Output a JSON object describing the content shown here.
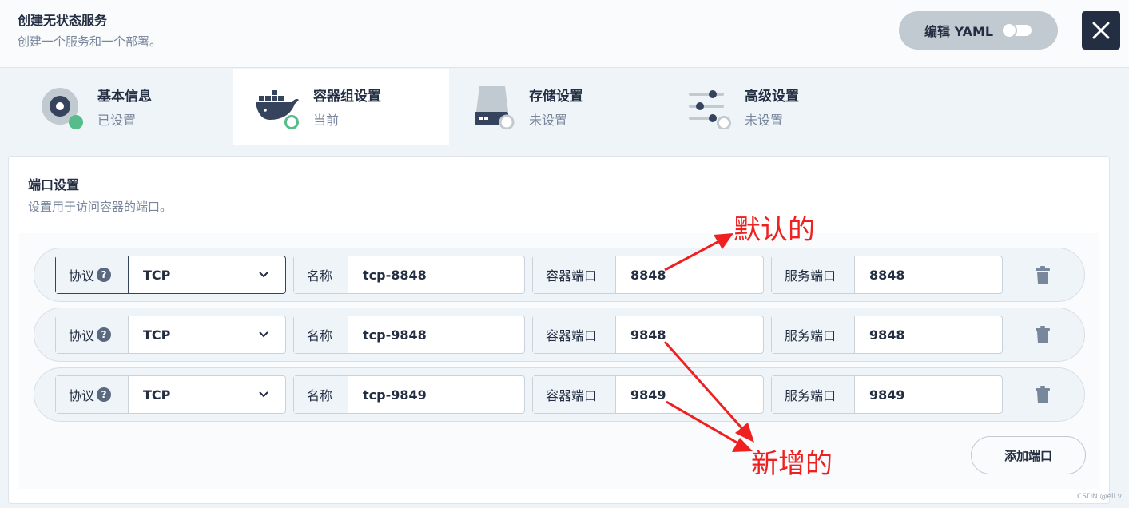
{
  "header": {
    "title": "创建无状态服务",
    "subtitle": "创建一个服务和一个部署。",
    "yaml_label": "编辑 YAML"
  },
  "steps": [
    {
      "name": "基本信息",
      "status": "已设置",
      "icon": "disc-icon"
    },
    {
      "name": "容器组设置",
      "status": "当前",
      "icon": "docker-whale-icon"
    },
    {
      "name": "存储设置",
      "status": "未设置",
      "icon": "storage-drive-icon"
    },
    {
      "name": "高级设置",
      "status": "未设置",
      "icon": "sliders-icon"
    }
  ],
  "panel": {
    "title": "端口设置",
    "description": "设置用于访问容器的端口。",
    "labels": {
      "protocol": "协议",
      "name": "名称",
      "container_port": "容器端口",
      "service_port": "服务端口",
      "help": "?"
    },
    "ports": [
      {
        "protocol": "TCP",
        "name": "tcp-8848",
        "container_port": "8848",
        "service_port": "8848"
      },
      {
        "protocol": "TCP",
        "name": "tcp-9848",
        "container_port": "9848",
        "service_port": "9848"
      },
      {
        "protocol": "TCP",
        "name": "tcp-9849",
        "container_port": "9849",
        "service_port": "9849"
      }
    ],
    "add_label": "添加端口"
  },
  "annotations": {
    "default": "默认的",
    "added": "新增的"
  },
  "watermark": "CSDN @elLv",
  "colors": {
    "accent": "#55bc8a",
    "dark": "#242e42",
    "annotation": "#ee2020"
  }
}
